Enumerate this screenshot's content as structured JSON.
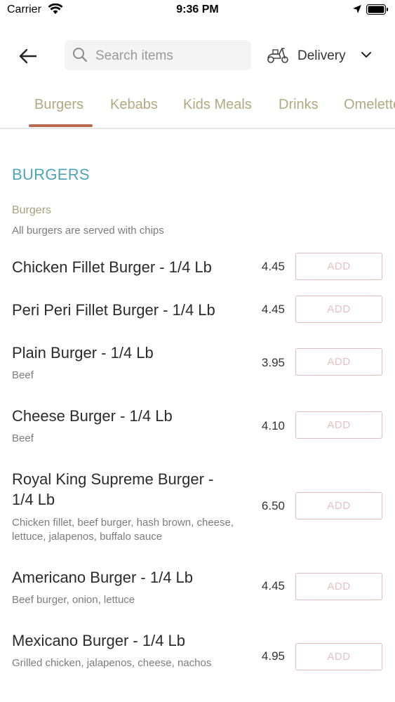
{
  "status_bar": {
    "carrier": "Carrier",
    "time": "9:36 PM"
  },
  "header": {
    "search_placeholder": "Search items",
    "delivery_label": "Delivery"
  },
  "tabs": [
    {
      "label": "Burgers",
      "active": true
    },
    {
      "label": "Kebabs"
    },
    {
      "label": "Kids Meals"
    },
    {
      "label": "Drinks"
    },
    {
      "label": "Omelettes"
    }
  ],
  "section": {
    "title": "BURGERS",
    "category_name": "Burgers",
    "category_desc": "All burgers are served with chips"
  },
  "add_label": "ADD",
  "items": [
    {
      "name": "Chicken Fillet Burger - 1/4 Lb",
      "desc": "",
      "price": "4.45"
    },
    {
      "name": "Peri Peri Fillet Burger - 1/4 Lb",
      "desc": "",
      "price": "4.45"
    },
    {
      "name": "Plain Burger - 1/4 Lb",
      "desc": "Beef",
      "price": "3.95"
    },
    {
      "name": "Cheese Burger - 1/4 Lb",
      "desc": "Beef",
      "price": "4.10"
    },
    {
      "name": "Royal King Supreme Burger - 1/4 Lb",
      "desc": "Chicken fillet, beef burger, hash brown, cheese, lettuce, jalapenos, buffalo sauce",
      "price": "6.50"
    },
    {
      "name": "Americano Burger - 1/4 Lb",
      "desc": "Beef burger, onion, lettuce",
      "price": "4.45"
    },
    {
      "name": "Mexicano Burger - 1/4 Lb",
      "desc": "Grilled chicken, jalapenos, cheese, nachos",
      "price": "4.95"
    }
  ],
  "colors": {
    "accent_tab": "#b3a980",
    "tab_indicator": "#b86b52",
    "section_title": "#4da4b3",
    "add_border": "#e1bcbc"
  },
  "icons": [
    "back-arrow-icon",
    "search-icon",
    "scooter-icon",
    "chevron-down-icon",
    "wifi-icon",
    "location-arrow-icon",
    "battery-icon"
  ]
}
